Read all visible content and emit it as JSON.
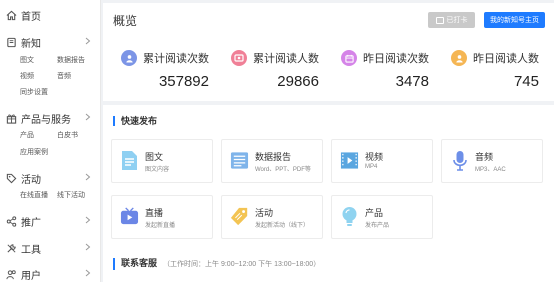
{
  "sidebar": {
    "home": "首页",
    "new": "新知",
    "new_items": [
      "图文",
      "数据报告",
      "视频",
      "音频",
      "同步设置"
    ],
    "products": "产品与服务",
    "product_items": [
      "产品",
      "白皮书",
      "应用案例"
    ],
    "activities": "活动",
    "activity_items": [
      "在线直播",
      "线下活动"
    ],
    "promotion": "推广",
    "tools": "工具",
    "users": "用户"
  },
  "overview": {
    "title": "概览",
    "disabled_button": "已打卡",
    "primary_button": "我的新知号主页",
    "stats": [
      {
        "label": "累计阅读次数",
        "value": "357892",
        "color": "#7c95e6",
        "icon": "person-icon"
      },
      {
        "label": "累计阅读人数",
        "value": "29866",
        "color": "#f08097",
        "icon": "eye-icon"
      },
      {
        "label": "昨日阅读次数",
        "value": "3478",
        "color": "#d584e8",
        "icon": "calendar-icon"
      },
      {
        "label": "昨日阅读人数",
        "value": "745",
        "color": "#f5b654",
        "icon": "person-icon"
      }
    ]
  },
  "quick_publish": {
    "title": "快速发布",
    "tiles": [
      {
        "name": "图文",
        "desc": "图文内容",
        "icon": "document-icon"
      },
      {
        "name": "数据报告",
        "desc": "Word、PPT、PDF等",
        "icon": "report-icon"
      },
      {
        "name": "视频",
        "desc": "MP4",
        "icon": "film-icon"
      },
      {
        "name": "音频",
        "desc": "MP3、AAC",
        "icon": "microphone-icon"
      },
      {
        "name": "直播",
        "desc": "发起新直播",
        "icon": "live-tv-icon"
      },
      {
        "name": "活动",
        "desc": "发起新活动（线下）",
        "icon": "tag-icon"
      },
      {
        "name": "产品",
        "desc": "发布产品",
        "icon": "bulb-icon"
      }
    ]
  },
  "customer_service": {
    "title": "联系客服",
    "hours": "（工作时间：上午 9:00~12:00 下午 13:00~18:00）"
  }
}
